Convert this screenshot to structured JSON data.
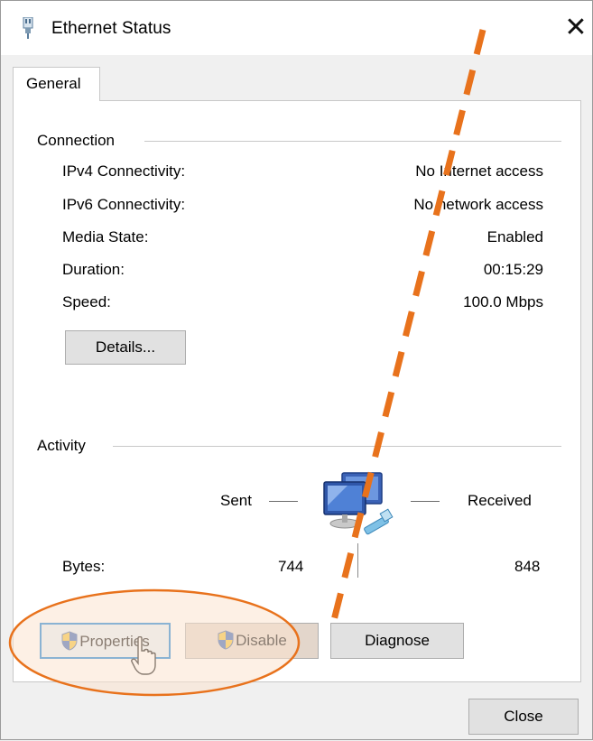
{
  "window": {
    "title": "Ethernet Status",
    "close_glyph": "✕",
    "title_icon": "ethernet-adapter-icon"
  },
  "tabs": [
    {
      "label": "General",
      "selected": true
    }
  ],
  "connection": {
    "group_label": "Connection",
    "rows": [
      {
        "label": "IPv4 Connectivity:",
        "value": "No Internet access"
      },
      {
        "label": "IPv6 Connectivity:",
        "value": "No network access"
      },
      {
        "label": "Media State:",
        "value": "Enabled"
      },
      {
        "label": "Duration:",
        "value": "00:15:29"
      },
      {
        "label": "Speed:",
        "value": "100.0 Mbps"
      }
    ],
    "details_button": "Details..."
  },
  "activity": {
    "group_label": "Activity",
    "sent_label": "Sent",
    "received_label": "Received",
    "bytes_label": "Bytes:",
    "bytes_sent": "744",
    "bytes_received": "848",
    "network_icon": "network-computers-icon"
  },
  "buttons": {
    "properties": "Properties",
    "disable": "Disable",
    "diagnose": "Diagnose",
    "close": "Close"
  },
  "annotation": {
    "highlight_color": "#e8721c",
    "highlight_fill": "#fbe3cf"
  }
}
